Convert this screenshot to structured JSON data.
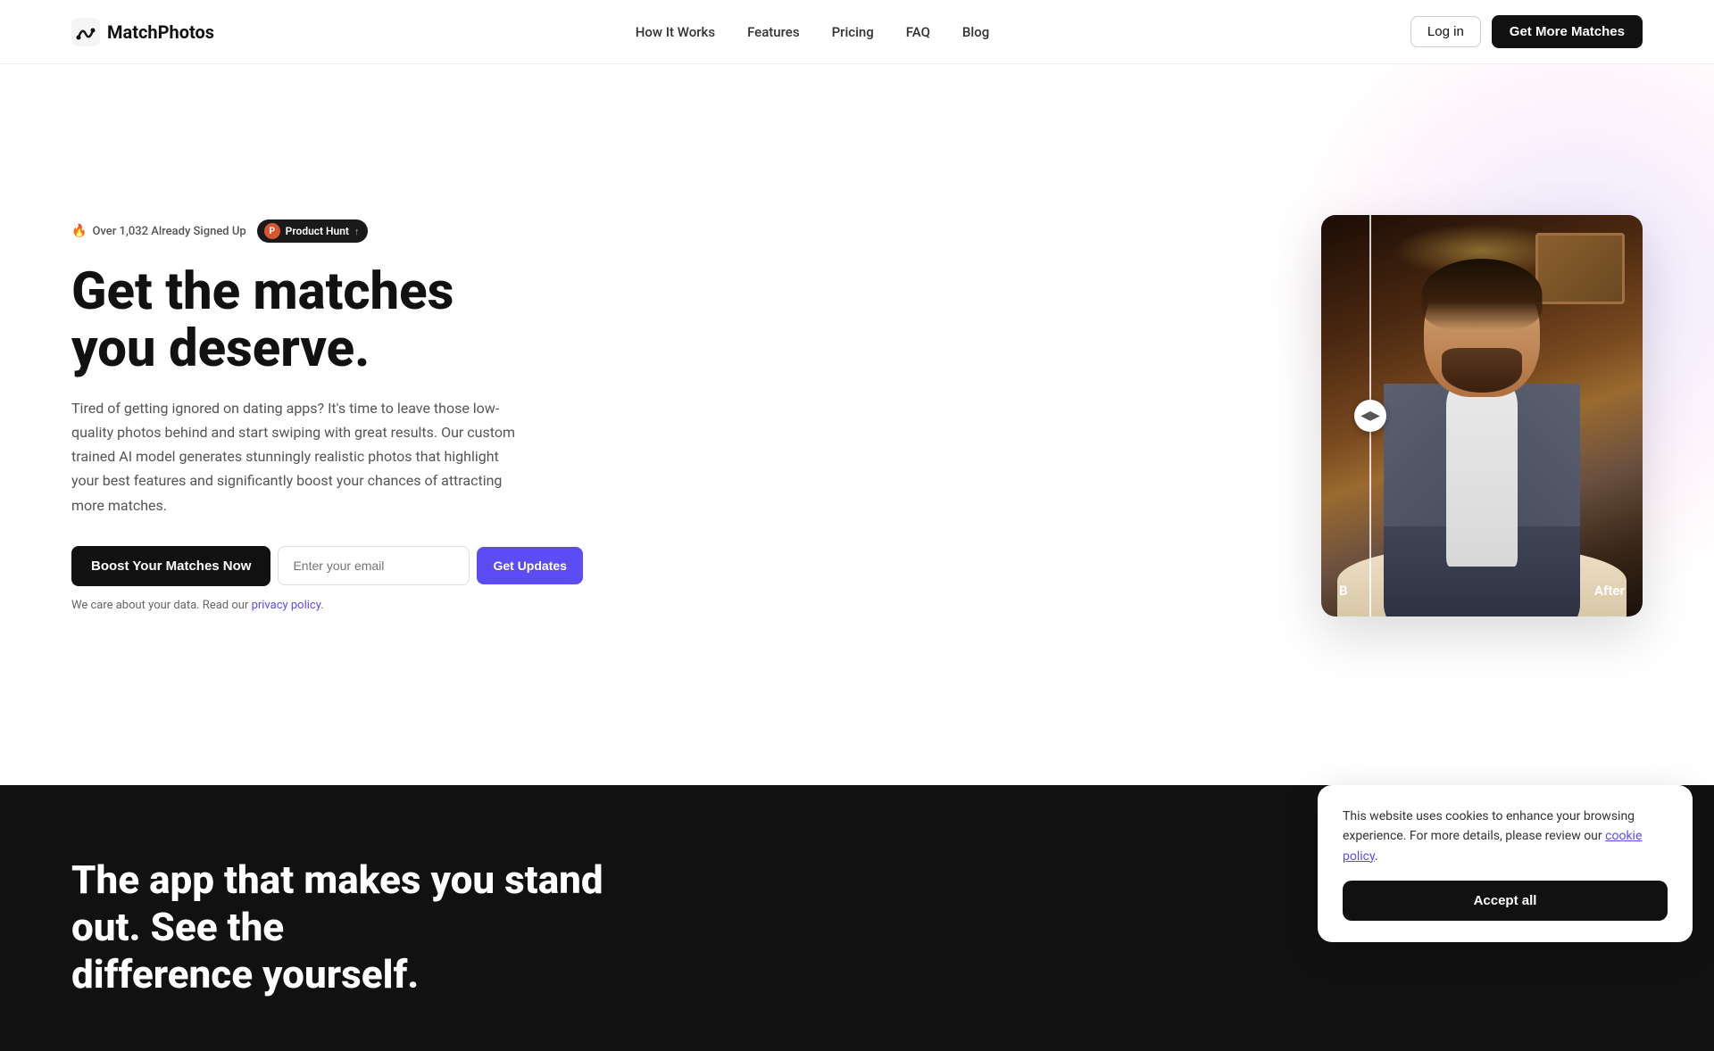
{
  "brand": {
    "name": "MatchPhotos",
    "logo_alt": "MatchPhotos logo"
  },
  "nav": {
    "links": [
      {
        "id": "how-it-works",
        "label": "How It Works"
      },
      {
        "id": "features",
        "label": "Features"
      },
      {
        "id": "pricing",
        "label": "Pricing"
      },
      {
        "id": "faq",
        "label": "FAQ"
      },
      {
        "id": "blog",
        "label": "Blog"
      }
    ],
    "login_label": "Log in",
    "cta_label": "Get More Matches"
  },
  "hero": {
    "badge_signed": "Over 1,032 Already Signed Up",
    "badge_ph_label": "Product Hunt",
    "badge_ph_count": "↑",
    "title_line1": "Get the matches",
    "title_line2": "you deserve.",
    "subtitle": "Tired of getting ignored on dating apps? It's time to leave those low-quality photos behind and start swiping with great results. Our custom trained AI model generates stunningly realistic photos that highlight your best features and significantly boost your chances of attracting more matches.",
    "cta_boost_label": "Boost Your Matches Now",
    "email_placeholder": "Enter your email",
    "btn_updates_label": "Get Updates",
    "privacy_text": "We care about your data. Read our",
    "privacy_link_label": "privacy policy",
    "before_label": "B",
    "after_label": "After",
    "slider_icon": "◀▶"
  },
  "dark_section": {
    "title_line1": "The app that makes you stand out. See the",
    "title_line2": "difference yourself."
  },
  "cookie": {
    "text": "This website uses cookies to enhance your browsing experience. For more details, please review our",
    "link_label": "cookie policy",
    "accept_label": "Accept all"
  }
}
